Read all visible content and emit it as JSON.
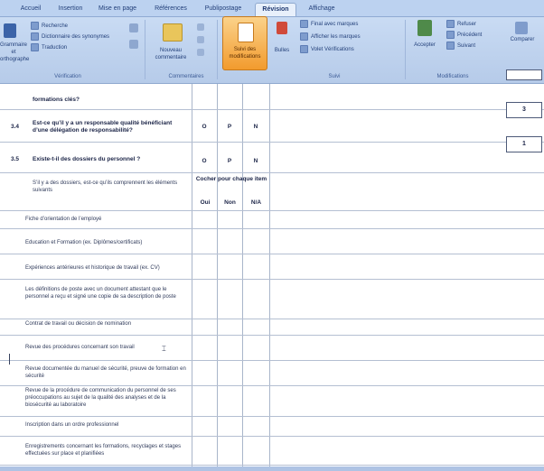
{
  "ribbon": {
    "tabs": [
      {
        "label": "Accueil"
      },
      {
        "label": "Insertion"
      },
      {
        "label": "Mise en page"
      },
      {
        "label": "Références"
      },
      {
        "label": "Publipostage"
      },
      {
        "label": "Révision"
      },
      {
        "label": "Affichage"
      }
    ],
    "groups": {
      "verification": "Vérification",
      "commentaires": "Commentaires",
      "suivi": "Suivi",
      "modifications": "Modifications"
    },
    "buttons": {
      "grammaire": "Grammaire et orthographe",
      "recherche": "Recherche",
      "dictionnaire": "Dictionnaire des synonymes",
      "traduction": "Traduction",
      "nouveau_commentaire": "Nouveau commentaire",
      "suivi_modifications": "Suivi des modifications",
      "bulles": "Bulles",
      "final_marques": "Final avec marques",
      "afficher_marques": "Afficher les marques",
      "volet": "Volet Vérifications",
      "accepter": "Accepter",
      "refuser": "Refuser",
      "precedent": "Précédent",
      "suivant": "Suivant",
      "comparer": "Comparer"
    },
    "accent": "#f29b2e"
  },
  "sheet": {
    "top_row_text": "formations clés?",
    "col_headers": {
      "o": "O",
      "p": "P",
      "n": "N"
    },
    "q34": {
      "number": "3.4",
      "text": "Est-ce qu’il y a un responsable qualité bénéficiant d’une délégation de responsabilité?",
      "score": "3"
    },
    "q35": {
      "number": "3.5",
      "text": "Existe-t-il des dossiers du personnel ?",
      "score": "1"
    },
    "sub_header": {
      "question": "S’il y a des dossiers, est-ce qu’ils comprennent les éléments suivants",
      "instruction": "Cocher pour chaque item",
      "oui": "Oui",
      "non": "Non",
      "na": "N/A"
    },
    "items": [
      "Fiche d’orientation de l’employé",
      "Education et Formation (ex. Diplômes/certificats)",
      "Expériences antérieures et historique de travail (ex. CV)",
      "Les définitions de poste avec un document attestant que le personnel a reçu et signé une copie de sa description de poste",
      "Contrat de travail ou décision de nomination",
      "Revue des procédures concernant son travail",
      "Revue documentée du manuel de sécurité, preuve de formation en sécurité",
      "Revue de la procédure de communication du personnel de ses préoccupations au sujet de la qualité des analyses et de la biosécurité au laboratoire",
      "Inscription dans un ordre professionnel",
      "Enregistrements concernant les formations, recyclages et stages effectuées sur place et planifiées"
    ]
  }
}
